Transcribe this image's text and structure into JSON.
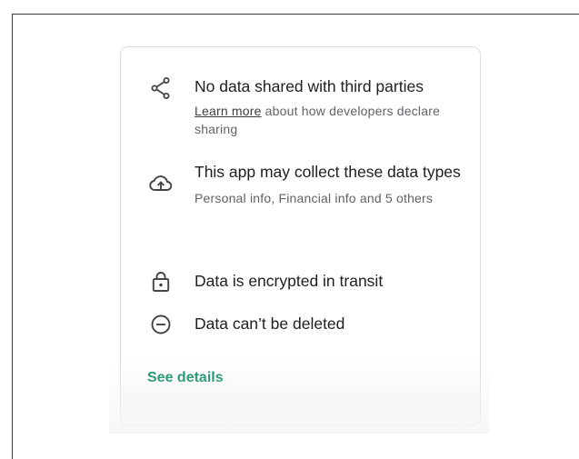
{
  "safety": {
    "items": [
      {
        "icon": "share-icon",
        "title": "No data shared with third parties",
        "link": "Learn more",
        "subtitle_rest": " about how developers declare sharing"
      },
      {
        "icon": "cloud-upload-icon",
        "title": "This app may collect these data types",
        "subtitle": "Personal info, Financial info and 5 others"
      },
      {
        "icon": "lock-icon",
        "title": "Data is encrypted in transit"
      },
      {
        "icon": "delete-circle-icon",
        "title": "Data can’t be deleted"
      }
    ],
    "see_details": "See details",
    "accent_color": "#01875f"
  }
}
